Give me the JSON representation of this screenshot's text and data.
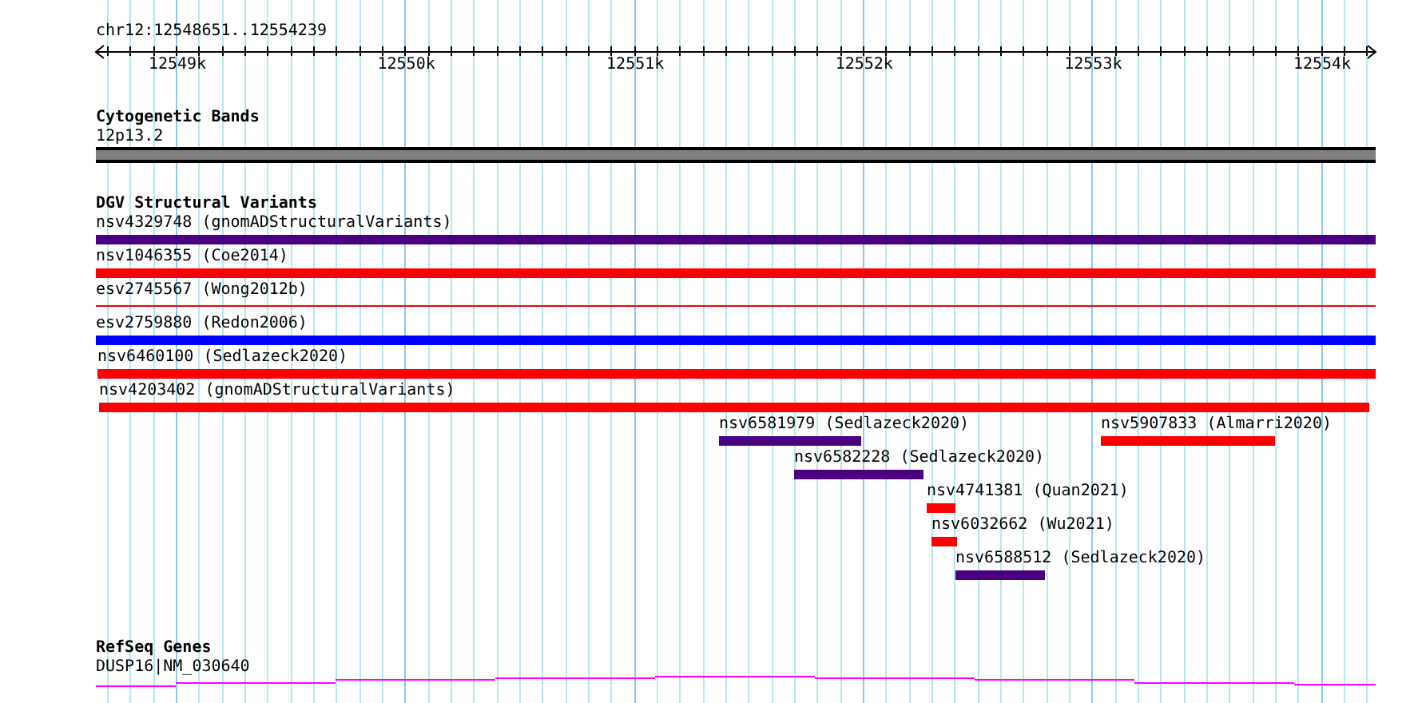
{
  "ruler": {
    "range": "chr12:12548651..12554239",
    "ticks": [
      "12549k",
      "12550k",
      "12551k",
      "12552k",
      "12553k",
      "12554k"
    ]
  },
  "tracks": [
    {
      "title": "Cytogenetic Bands",
      "features": [
        {
          "label": "12p13.2",
          "kind": "band"
        }
      ]
    },
    {
      "title": "DGV Structural Variants",
      "features": [
        {
          "label": "nsv4329748 (gnomADStructuralVariants)",
          "kind": "thick",
          "color": "#4b0082"
        },
        {
          "label": "nsv1046355 (Coe2014)",
          "kind": "thick",
          "color": "#ff0000"
        },
        {
          "label": "esv2745567 (Wong2012b)",
          "kind": "thin",
          "color": "#ff0000"
        },
        {
          "label": "esv2759880 (Redon2006)",
          "kind": "thick",
          "color": "#0000ff"
        },
        {
          "label": "nsv6460100 (Sedlazeck2020)",
          "kind": "thick",
          "color": "#ff0000"
        },
        {
          "label": "nsv4203402 (gnomADStructuralVariants)",
          "kind": "thick",
          "color": "#ff0000"
        },
        {
          "label": "nsv6581979 (Sedlazeck2020)",
          "kind": "thick",
          "color": "#4b0082"
        },
        {
          "label": "nsv5907833 (Almarri2020)",
          "kind": "thick",
          "color": "#ff0000"
        },
        {
          "label": "nsv6582228 (Sedlazeck2020)",
          "kind": "thick",
          "color": "#4b0082"
        },
        {
          "label": "nsv4741381 (Quan2021)",
          "kind": "thick",
          "color": "#ff0000"
        },
        {
          "label": "nsv6032662 (Wu2021)",
          "kind": "thick",
          "color": "#ff0000"
        },
        {
          "label": "nsv6588512 (Sedlazeck2020)",
          "kind": "thick",
          "color": "#4b0082"
        }
      ]
    },
    {
      "title": "RefSeq Genes",
      "features": [
        {
          "label": "DUSP16|NM_030640",
          "kind": "gene"
        }
      ]
    }
  ]
}
